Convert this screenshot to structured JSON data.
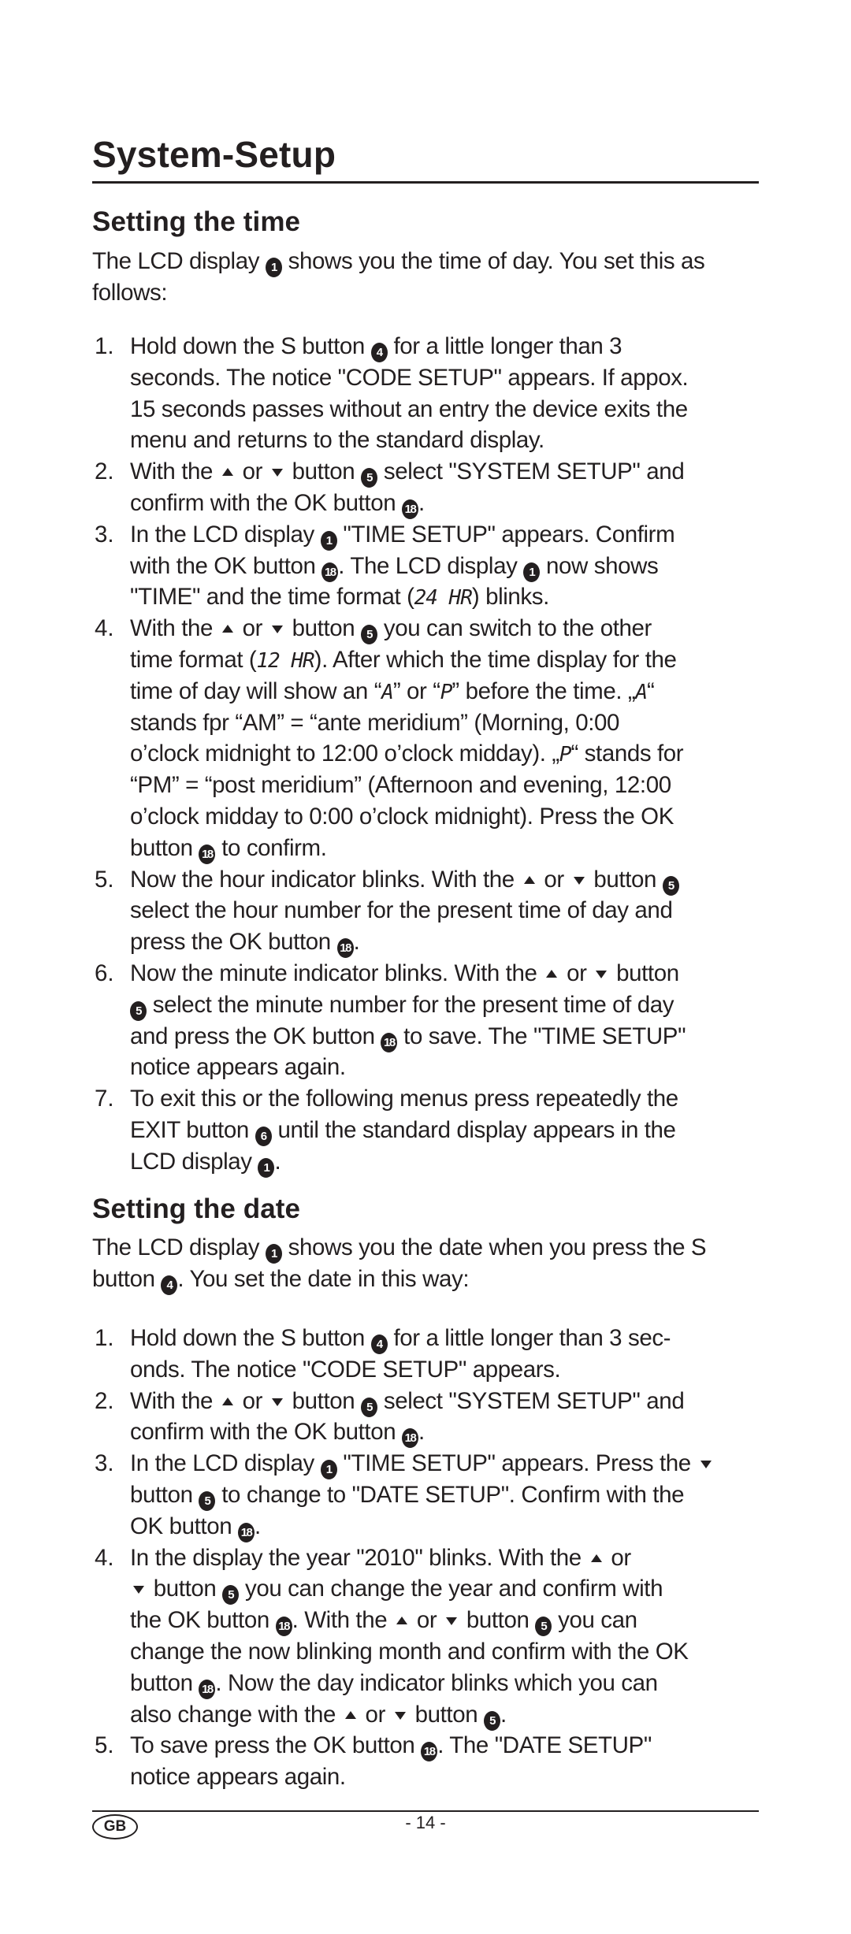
{
  "title": "System-Setup",
  "sections": [
    {
      "heading": "Setting the time",
      "intro": [
        [
          {
            "t": "The LCD display "
          },
          {
            "c": "1"
          },
          {
            "t": " shows you the time of day. You set this as"
          }
        ],
        [
          {
            "t": "follows:"
          }
        ]
      ],
      "items": [
        {
          "number": "1.",
          "lines": [
            [
              {
                "t": "Hold down the S button "
              },
              {
                "c": "4"
              },
              {
                "t": " for a little longer than 3"
              }
            ],
            [
              {
                "t": "seconds. The notice \"CODE SETUP\" appears. If appox."
              }
            ],
            [
              {
                "t": "15 seconds passes without an entry the device exits the"
              }
            ],
            [
              {
                "t": "menu and returns to the standard display."
              }
            ]
          ]
        },
        {
          "number": "2.",
          "lines": [
            [
              {
                "t": "With the "
              },
              {
                "u": "up"
              },
              {
                "t": " or "
              },
              {
                "d": "down"
              },
              {
                "t": " button "
              },
              {
                "c": "5"
              },
              {
                "t": " select \"SYSTEM SETUP\" and"
              }
            ],
            [
              {
                "t": "confirm with the OK button "
              },
              {
                "c": "18"
              },
              {
                "t": "."
              }
            ]
          ]
        },
        {
          "number": "3.",
          "lines": [
            [
              {
                "t": "In the LCD display "
              },
              {
                "c": "1"
              },
              {
                "t": " \"TIME SETUP\" appears. Confirm"
              }
            ],
            [
              {
                "t": "with the OK button "
              },
              {
                "c": "18"
              },
              {
                "t": ".  The LCD display "
              },
              {
                "c": "1"
              },
              {
                "t": " now shows"
              }
            ],
            [
              {
                "t": "\"TIME\" and the time format ("
              },
              {
                "l": "24 HR"
              },
              {
                "t": ") blinks."
              }
            ]
          ]
        },
        {
          "number": "4.",
          "lines": [
            [
              {
                "t": "With the "
              },
              {
                "u": "up"
              },
              {
                "t": " or "
              },
              {
                "d": "down"
              },
              {
                "t": " button "
              },
              {
                "c": "5"
              },
              {
                "t": " you can switch to the other"
              }
            ],
            [
              {
                "t": "time format ("
              },
              {
                "l": "12 HR"
              },
              {
                "t": "). After which the time display for the"
              }
            ],
            [
              {
                "t": "time of day will show an “"
              },
              {
                "l": "A"
              },
              {
                "t": "” or “"
              },
              {
                "l": "P"
              },
              {
                "t": "” before the time. „"
              },
              {
                "l": "A"
              },
              {
                "t": "“"
              }
            ],
            [
              {
                "t": "stands fpr “AM” = “ante meridium” (Morning, 0:00"
              }
            ],
            [
              {
                "t": "o’clock midnight to 12:00 o’clock midday). „"
              },
              {
                "l": "P"
              },
              {
                "t": "“ stands for"
              }
            ],
            [
              {
                "t": "“PM” = “post meridium” (Afternoon and evening, 12:00"
              }
            ],
            [
              {
                "t": "o’clock midday to 0:00 o’clock midnight). Press the OK"
              }
            ],
            [
              {
                "t": "button "
              },
              {
                "c": "18"
              },
              {
                "t": " to confirm."
              }
            ]
          ]
        },
        {
          "number": "5.",
          "lines": [
            [
              {
                "t": "Now the hour indicator blinks. With the "
              },
              {
                "u": "up"
              },
              {
                "t": " or "
              },
              {
                "d": "down"
              },
              {
                "t": " button "
              },
              {
                "c": "5"
              }
            ],
            [
              {
                "t": "select the hour number for the present time of day and"
              }
            ],
            [
              {
                "t": "press the OK button "
              },
              {
                "c": "18"
              },
              {
                "t": "."
              }
            ]
          ]
        },
        {
          "number": "6.",
          "lines": [
            [
              {
                "t": "Now the minute indicator blinks. With the "
              },
              {
                "u": "up"
              },
              {
                "t": " or "
              },
              {
                "d": "down"
              },
              {
                "t": " button"
              }
            ],
            [
              {
                "c": "5"
              },
              {
                "t": " select the minute number for the present time of day"
              }
            ],
            [
              {
                "t": "and press the OK button "
              },
              {
                "c": "18"
              },
              {
                "t": " to save. The \"TIME SETUP\""
              }
            ],
            [
              {
                "t": "notice appears again."
              }
            ]
          ]
        },
        {
          "number": "7.",
          "lines": [
            [
              {
                "t": "To exit this or the following menus press repeatedly the"
              }
            ],
            [
              {
                "t": "EXIT button "
              },
              {
                "c": "6"
              },
              {
                "t": " until the standard display appears in the"
              }
            ],
            [
              {
                "t": "LCD display "
              },
              {
                "c": "1"
              },
              {
                "t": "."
              }
            ]
          ]
        }
      ]
    },
    {
      "heading": "Setting the date",
      "intro": [
        [
          {
            "t": "The LCD display "
          },
          {
            "c": "1"
          },
          {
            "t": " shows you the date when you press the S"
          }
        ],
        [
          {
            "t": "button "
          },
          {
            "c": "4"
          },
          {
            "t": ". You set the date in this way:"
          }
        ]
      ],
      "items": [
        {
          "number": "1.",
          "lines": [
            [
              {
                "t": "Hold down the S button "
              },
              {
                "c": "4"
              },
              {
                "t": " for a little longer than 3 sec-"
              }
            ],
            [
              {
                "t": "onds. The notice \"CODE SETUP\" appears."
              }
            ]
          ]
        },
        {
          "number": "2.",
          "lines": [
            [
              {
                "t": "With the "
              },
              {
                "u": "up"
              },
              {
                "t": " or "
              },
              {
                "d": "down"
              },
              {
                "t": " button "
              },
              {
                "c": "5"
              },
              {
                "t": " select \"SYSTEM SETUP\" and"
              }
            ],
            [
              {
                "t": "confirm with the OK button "
              },
              {
                "c": "18"
              },
              {
                "t": "."
              }
            ]
          ]
        },
        {
          "number": "3.",
          "lines": [
            [
              {
                "t": "In the LCD display "
              },
              {
                "c": "1"
              },
              {
                "t": " \"TIME SETUP\" appears. Press the "
              },
              {
                "d": "down"
              }
            ],
            [
              {
                "t": "button "
              },
              {
                "c": "5"
              },
              {
                "t": " to change to \"DATE SETUP\". Confirm with the"
              }
            ],
            [
              {
                "t": "OK button "
              },
              {
                "c": "18"
              },
              {
                "t": "."
              }
            ]
          ]
        },
        {
          "number": "4.",
          "lines": [
            [
              {
                "t": "In the display the year \"2010\" blinks. With the "
              },
              {
                "u": "up"
              },
              {
                "t": " or"
              }
            ],
            [
              {
                "d": "down"
              },
              {
                "t": " button "
              },
              {
                "c": "5"
              },
              {
                "t": " you can change the year and confirm with"
              }
            ],
            [
              {
                "t": "the OK button "
              },
              {
                "c": "18"
              },
              {
                "t": ". With the "
              },
              {
                "u": "up"
              },
              {
                "t": " or "
              },
              {
                "d": "down"
              },
              {
                "t": " button "
              },
              {
                "c": "5"
              },
              {
                "t": " you can"
              }
            ],
            [
              {
                "t": "change the now blinking month and confirm with the OK"
              }
            ],
            [
              {
                "t": "button "
              },
              {
                "c": "18"
              },
              {
                "t": ". Now the day indicator blinks which you can"
              }
            ],
            [
              {
                "t": "also change with the "
              },
              {
                "u": "up"
              },
              {
                "t": " or "
              },
              {
                "d": "down"
              },
              {
                "t": " button "
              },
              {
                "c": "5"
              },
              {
                "t": "."
              }
            ]
          ]
        },
        {
          "number": "5.",
          "lines": [
            [
              {
                "t": "To save press the OK button "
              },
              {
                "c": "18"
              },
              {
                "t": ". The \"DATE SETUP\""
              }
            ],
            [
              {
                "t": "notice appears again."
              }
            ]
          ]
        }
      ]
    }
  ],
  "footer": {
    "country_badge": "GB",
    "page_number": "- 14 -"
  },
  "colors": {
    "text": "#231f20",
    "background": "#ffffff"
  }
}
